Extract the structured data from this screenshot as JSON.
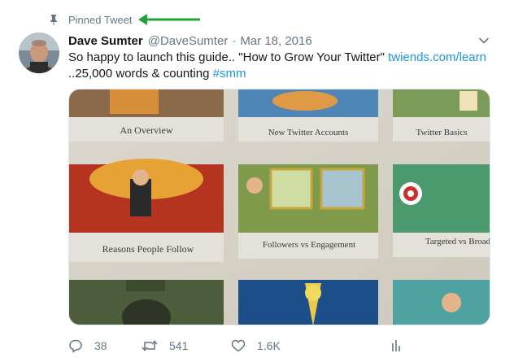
{
  "pinned": {
    "label": "Pinned Tweet",
    "arrow_color": "#1fa23a"
  },
  "tweet": {
    "author_name": "Dave Sumter",
    "handle": "@DaveSumter",
    "separator": "·",
    "date": "Mar 18, 2016",
    "text_part1": "So happy to launch this guide.. \"How to Grow Your Twitter\" ",
    "link": "twiends.com/learn",
    "text_part2": "..25,000 words & counting ",
    "hashtag": "#smm"
  },
  "media": {
    "panels": [
      {
        "label": "An Overview"
      },
      {
        "label": "New Twitter Accounts"
      },
      {
        "label": "Twitter Basics"
      },
      {
        "label": "Reasons People Follow"
      },
      {
        "label": "Followers vs Engagement"
      },
      {
        "label": "Targeted vs Broad"
      }
    ]
  },
  "actions": {
    "reply_count": "38",
    "retweet_count": "541",
    "like_count": "1.6K"
  },
  "colors": {
    "link": "#1b95e0",
    "secondary_text": "#657786",
    "primary_text": "#14171a"
  },
  "icons": [
    "pin-icon",
    "caret-down-icon",
    "reply-icon",
    "retweet-icon",
    "like-icon",
    "analytics-icon"
  ]
}
